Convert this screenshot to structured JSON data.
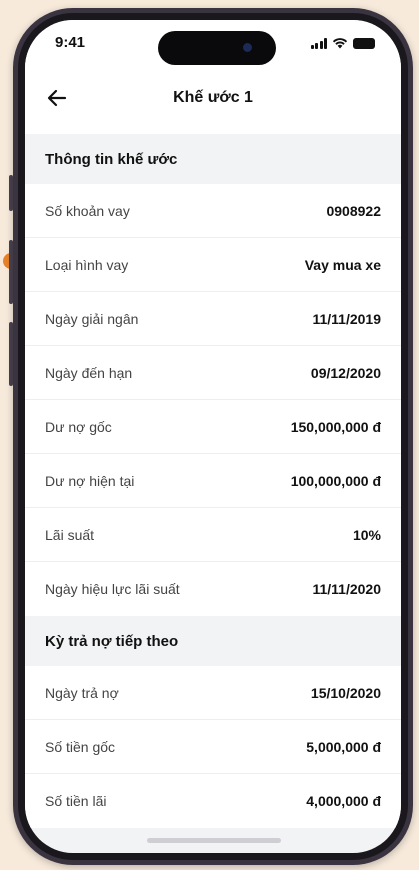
{
  "status_bar": {
    "time": "9:41"
  },
  "header": {
    "title": "Khế ước 1",
    "back_icon": "arrow-left-icon"
  },
  "contract_info": {
    "heading": "Thông tin khế ước",
    "rows": [
      {
        "label": "Số khoản vay",
        "value": "0908922"
      },
      {
        "label": "Loại hình vay",
        "value": "Vay mua xe"
      },
      {
        "label": "Ngày giải ngân",
        "value": "11/11/2019"
      },
      {
        "label": "Ngày đến hạn",
        "value": "09/12/2020"
      },
      {
        "label": "Dư nợ gốc",
        "value": "150,000,000 đ"
      },
      {
        "label": "Dư nợ hiện tại",
        "value": "100,000,000 đ"
      },
      {
        "label": "Lãi suất",
        "value": "10%"
      },
      {
        "label": "Ngày hiệu lực lãi suất",
        "value": "11/11/2020"
      }
    ]
  },
  "next_payment": {
    "heading": "Kỳ trả nợ tiếp theo",
    "rows": [
      {
        "label": "Ngày trả nợ",
        "value": "15/10/2020"
      },
      {
        "label": "Số tiền gốc",
        "value": "5,000,000 đ"
      },
      {
        "label": "Số tiền lãi",
        "value": "4,000,000 đ"
      }
    ]
  },
  "colors": {
    "background": "#f7eadb",
    "accent": "#e8822a",
    "section_bg": "#f2f3f5",
    "card_bg": "#ffffff"
  }
}
